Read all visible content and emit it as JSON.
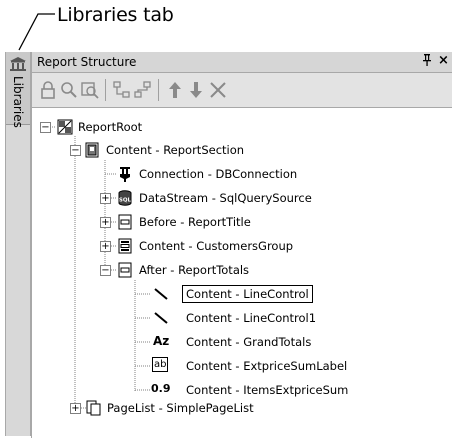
{
  "callout": {
    "label": "Libraries tab"
  },
  "sidebar": {
    "tab_label": "Libraries",
    "icon": "library-icon"
  },
  "panel": {
    "title": "Report Structure",
    "pin_icon": "pin-icon",
    "close_icon": "close-icon",
    "pin_glyph": "ᵖ",
    "close_glyph": "×"
  },
  "toolbar": {
    "buttons": [
      "lock-icon",
      "find-icon",
      "find-next-icon",
      "move-in-icon",
      "move-out-icon",
      "move-up-icon",
      "move-down-icon",
      "delete-icon"
    ]
  },
  "tree": {
    "root": "ReportRoot",
    "content_section": "Content - ReportSection",
    "connection": "Connection - DBConnection",
    "datastream": "DataStream - SqlQuerySource",
    "before": "Before - ReportTitle",
    "customers_group": "Content - CustomersGroup",
    "after": "After - ReportTotals",
    "line_control": "Content - LineControl",
    "line_control1": "Content - LineControl1",
    "grand_totals": "Content - GrandTotals",
    "extprice_sum_label": "Content - ExtpriceSumLabel",
    "items_extprice_sum": "Content - ItemsExtpriceSum",
    "pagelist": "PageList - SimplePageList",
    "grand_totals_glyph": "Az",
    "label_glyph": "ab",
    "number_glyph": "0.9",
    "sql_glyph": "SQL"
  }
}
